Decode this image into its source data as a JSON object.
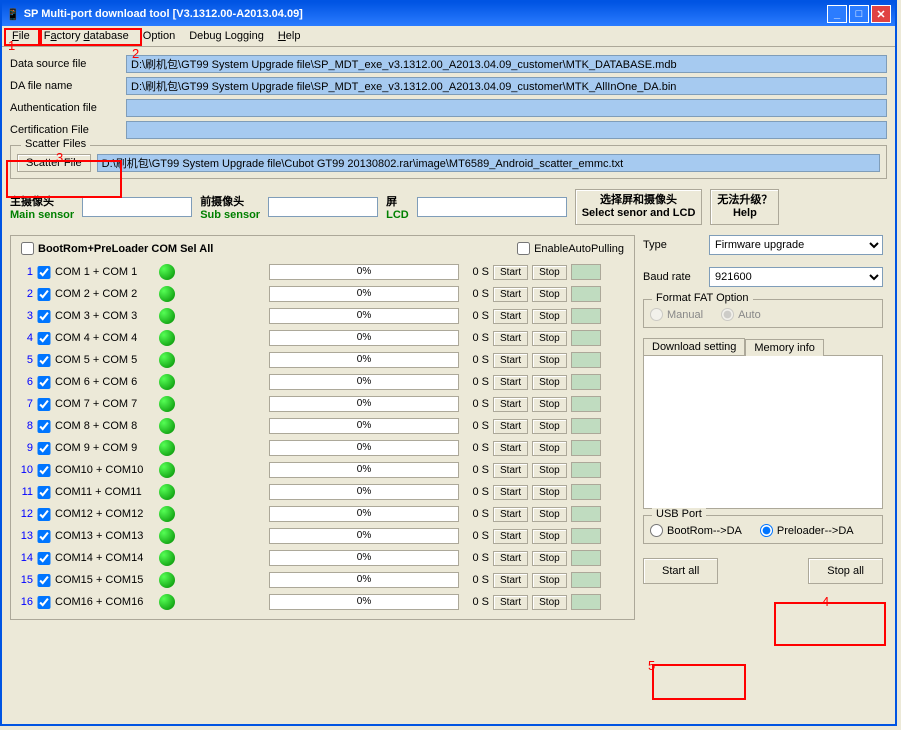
{
  "title": "SP Multi-port download tool [V3.1312.00-A2013.04.09]",
  "menu": [
    "File",
    "Factory database",
    "Option",
    "Debug Logging",
    "Help"
  ],
  "fields": {
    "data_source_label": "Data source file",
    "data_source_value": "D:\\刷机包\\GT99 System Upgrade file\\SP_MDT_exe_v3.1312.00_A2013.04.09_customer\\MTK_DATABASE.mdb",
    "da_label": "DA file name",
    "da_value": "D:\\刷机包\\GT99 System Upgrade file\\SP_MDT_exe_v3.1312.00_A2013.04.09_customer\\MTK_AllInOne_DA.bin",
    "auth_label": "Authentication file",
    "auth_value": "",
    "cert_label": "Certification File",
    "cert_value": ""
  },
  "scatter": {
    "legend": "Scatter Files",
    "button": "Scatter File",
    "value": "D:\\刷机包\\GT99 System Upgrade file\\Cubot GT99 20130802.rar\\image\\MT6589_Android_scatter_emmc.txt"
  },
  "sensors": {
    "main_cn": "主摄像头",
    "main_en": "Main sensor",
    "sub_cn": "前摄像头",
    "sub_en": "Sub sensor",
    "lcd_cn": "屏",
    "lcd_en": "LCD",
    "select_cn": "选择屏和摄像头",
    "select_en": "Select senor and LCD",
    "help_cn": "无法升级？",
    "help_en": "Help"
  },
  "com_header": {
    "sel_all": "BootRom+PreLoader COM Sel All",
    "auto_pull": "EnableAutoPulling"
  },
  "com_rows": [
    {
      "i": 1,
      "name": "COM 1 + COM 1"
    },
    {
      "i": 2,
      "name": "COM 2 + COM 2"
    },
    {
      "i": 3,
      "name": "COM 3 + COM 3"
    },
    {
      "i": 4,
      "name": "COM 4 + COM 4"
    },
    {
      "i": 5,
      "name": "COM 5 + COM 5"
    },
    {
      "i": 6,
      "name": "COM 6 + COM 6"
    },
    {
      "i": 7,
      "name": "COM 7 + COM 7"
    },
    {
      "i": 8,
      "name": "COM 8 + COM 8"
    },
    {
      "i": 9,
      "name": "COM 9 + COM 9"
    },
    {
      "i": 10,
      "name": "COM10 + COM10"
    },
    {
      "i": 11,
      "name": "COM11 + COM11"
    },
    {
      "i": 12,
      "name": "COM12 + COM12"
    },
    {
      "i": 13,
      "name": "COM13 + COM13"
    },
    {
      "i": 14,
      "name": "COM14 + COM14"
    },
    {
      "i": 15,
      "name": "COM15 + COM15"
    },
    {
      "i": 16,
      "name": "COM16 + COM16"
    }
  ],
  "com_common": {
    "progress": "0%",
    "time": "0 S",
    "start": "Start",
    "stop": "Stop"
  },
  "right": {
    "type_label": "Type",
    "type_value": "Firmware upgrade",
    "baud_label": "Baud rate",
    "baud_value": "921600",
    "fat_legend": "Format FAT Option",
    "fat_manual": "Manual",
    "fat_auto": "Auto",
    "tab_dl": "Download setting",
    "tab_mem": "Memory info",
    "usb_legend": "USB Port",
    "usb_boot": "BootRom-->DA",
    "usb_pre": "Preloader-->DA",
    "start_all": "Start all",
    "stop_all": "Stop all"
  },
  "annotations": {
    "a1": "1",
    "a2": "2",
    "a3": "3",
    "a4": "4",
    "a5": "5"
  }
}
